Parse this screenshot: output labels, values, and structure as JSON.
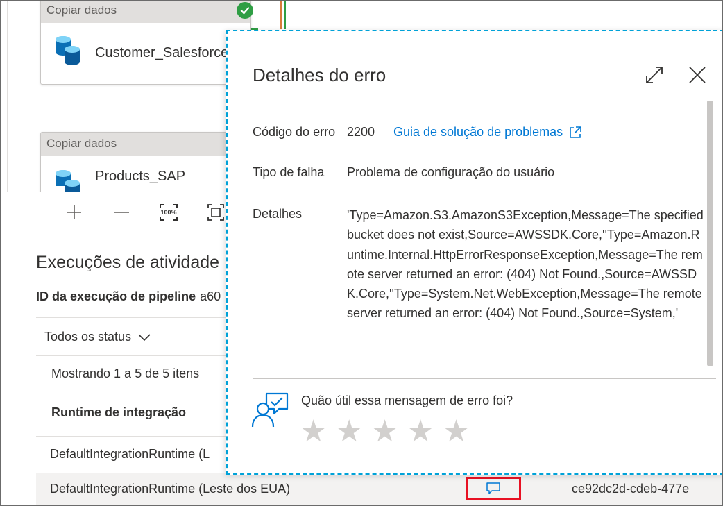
{
  "canvas": {
    "activities": [
      {
        "header": "Copiar dados",
        "name": "Customer_Salesforce",
        "status_icon": "check-circle-icon"
      },
      {
        "header": "Copiar dados",
        "name": "Products_SAP",
        "status_icon": ""
      }
    ],
    "toolbar": {
      "zoom_in_icon": "plus-icon",
      "zoom_out_icon": "minus-icon",
      "zoom_100_label": "100%",
      "fit_icon": "fit-to-screen-icon"
    }
  },
  "runs": {
    "title": "Execuções de atividade",
    "pipeline_id_label": "ID da execução de pipeline",
    "pipeline_id_value": "a60",
    "status_filter": "Todos os status",
    "showing": "Mostrando 1 a 5 de 5 itens",
    "column_header": "Runtime de integração",
    "rows": [
      {
        "runtime": "DefaultIntegrationRuntime (L"
      },
      {
        "runtime": "DefaultIntegrationRuntime (Leste dos EUA)",
        "run_id": "ce92dc2d-cdeb-477e"
      }
    ]
  },
  "error_panel": {
    "title": "Detalhes do erro",
    "code_label": "Código do erro",
    "code_value": "2200",
    "guide_link": "Guia de solução de problemas",
    "failure_type_label": "Tipo de falha",
    "failure_type_value": "Problema de configuração do usuário",
    "details_label": "Detalhes",
    "details_value": "'Type=Amazon.S3.AmazonS3Exception,Message=The specified bucket does not exist,Source=AWSSDK.Core,''Type=Amazon.Runtime.Internal.HttpErrorResponseException,Message=The remote server returned an error: (404) Not Found.,Source=AWSSDK.Core,''Type=System.Net.WebException,Message=The remote server returned an error: (404) Not Found.,Source=System,'",
    "feedback_question": "Quão útil essa mensagem de erro foi?",
    "star_count": 5,
    "rating": 0
  },
  "colors": {
    "accent": "#0078d4",
    "success": "#2f9e44",
    "highlight": "#e81123",
    "panel_border": "#00a2d8",
    "star_empty": "#d2d0ce"
  }
}
